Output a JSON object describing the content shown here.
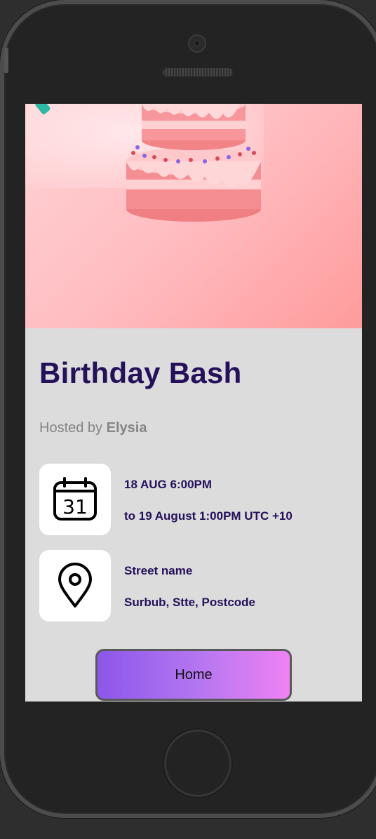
{
  "event": {
    "title": "Birthday Bash",
    "hosted_prefix": "Hosted by",
    "host_name": "Elysia"
  },
  "schedule": {
    "icon": "calendar-icon",
    "calendar_day": "31",
    "start": "18 AUG 6:00PM",
    "end": "to 19 August 1:00PM UTC +10"
  },
  "location": {
    "icon": "map-pin-icon",
    "street": "Street name",
    "locality": "Surbub, Stte, Postcode"
  },
  "actions": {
    "home_label": "Home"
  },
  "colors": {
    "title": "#25105a",
    "screen_bg": "#dcdcdc",
    "button_gradient_start": "#8b57ea",
    "button_gradient_end": "#ef82f4"
  }
}
